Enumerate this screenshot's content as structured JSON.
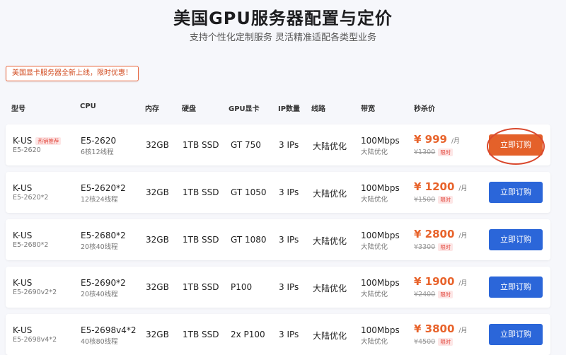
{
  "header": {
    "title": "美国GPU服务器配置与定价",
    "subtitle": "支持个性化定制服务 灵活精准适配各类型业务",
    "notice": "美国显卡服务器全新上线，限时优惠！"
  },
  "columns": [
    "型号",
    "CPU",
    "内存",
    "硬盘",
    "GPU显卡",
    "IP数量",
    "线路",
    "带宽",
    "秒杀价"
  ],
  "colors": {
    "price": "#e8632b",
    "button_blue": "#2b66d9",
    "button_orange": "#e4612a",
    "highlight_ring": "#d9482d"
  },
  "rows": [
    {
      "model": "K-US",
      "model_sub": "E5-2620",
      "hot_badge": "热销推荐",
      "cpu": "E5-2620",
      "cpu_sub": "6核12线程",
      "ram": "32GB",
      "disk": "1TB SSD",
      "gpu": "GT 750",
      "ips": "3 IPs",
      "line": "大陆优化",
      "bw": "100Mbps",
      "bw_sub": "大陆优化",
      "price": "¥ 999",
      "per": "/月",
      "old": "¥1300",
      "tag": "限时",
      "btn": "立即订购"
    },
    {
      "model": "K-US",
      "model_sub": "E5-2620*2",
      "hot_badge": "",
      "cpu": "E5-2620*2",
      "cpu_sub": "12核24线程",
      "ram": "32GB",
      "disk": "1TB SSD",
      "gpu": "GT 1050",
      "ips": "3 IPs",
      "line": "大陆优化",
      "bw": "100Mbps",
      "bw_sub": "大陆优化",
      "price": "¥ 1200",
      "per": "/月",
      "old": "¥1500",
      "tag": "限时",
      "btn": "立即订购"
    },
    {
      "model": "K-US",
      "model_sub": "E5-2680*2",
      "hot_badge": "",
      "cpu": "E5-2680*2",
      "cpu_sub": "20核40线程",
      "ram": "32GB",
      "disk": "1TB SSD",
      "gpu": "GT 1080",
      "ips": "3 IPs",
      "line": "大陆优化",
      "bw": "100Mbps",
      "bw_sub": "大陆优化",
      "price": "¥ 2800",
      "per": "/月",
      "old": "¥3300",
      "tag": "限时",
      "btn": "立即订购"
    },
    {
      "model": "K-US",
      "model_sub": "E5-2690v2*2",
      "hot_badge": "",
      "cpu": "E5-2690*2",
      "cpu_sub": "20核40线程",
      "ram": "32GB",
      "disk": "1TB SSD",
      "gpu": "P100",
      "ips": "3 IPs",
      "line": "大陆优化",
      "bw": "100Mbps",
      "bw_sub": "大陆优化",
      "price": "¥ 1900",
      "per": "/月",
      "old": "¥2400",
      "tag": "限时",
      "btn": "立即订购"
    },
    {
      "model": "K-US",
      "model_sub": "E5-2698v4*2",
      "hot_badge": "",
      "cpu": "E5-2698v4*2",
      "cpu_sub": "40核80线程",
      "ram": "32GB",
      "disk": "1TB SSD",
      "gpu": "2x P100",
      "ips": "3 IPs",
      "line": "大陆优化",
      "bw": "100Mbps",
      "bw_sub": "大陆优化",
      "price": "¥ 3800",
      "per": "/月",
      "old": "¥4500",
      "tag": "限时",
      "btn": "立即订购"
    }
  ]
}
